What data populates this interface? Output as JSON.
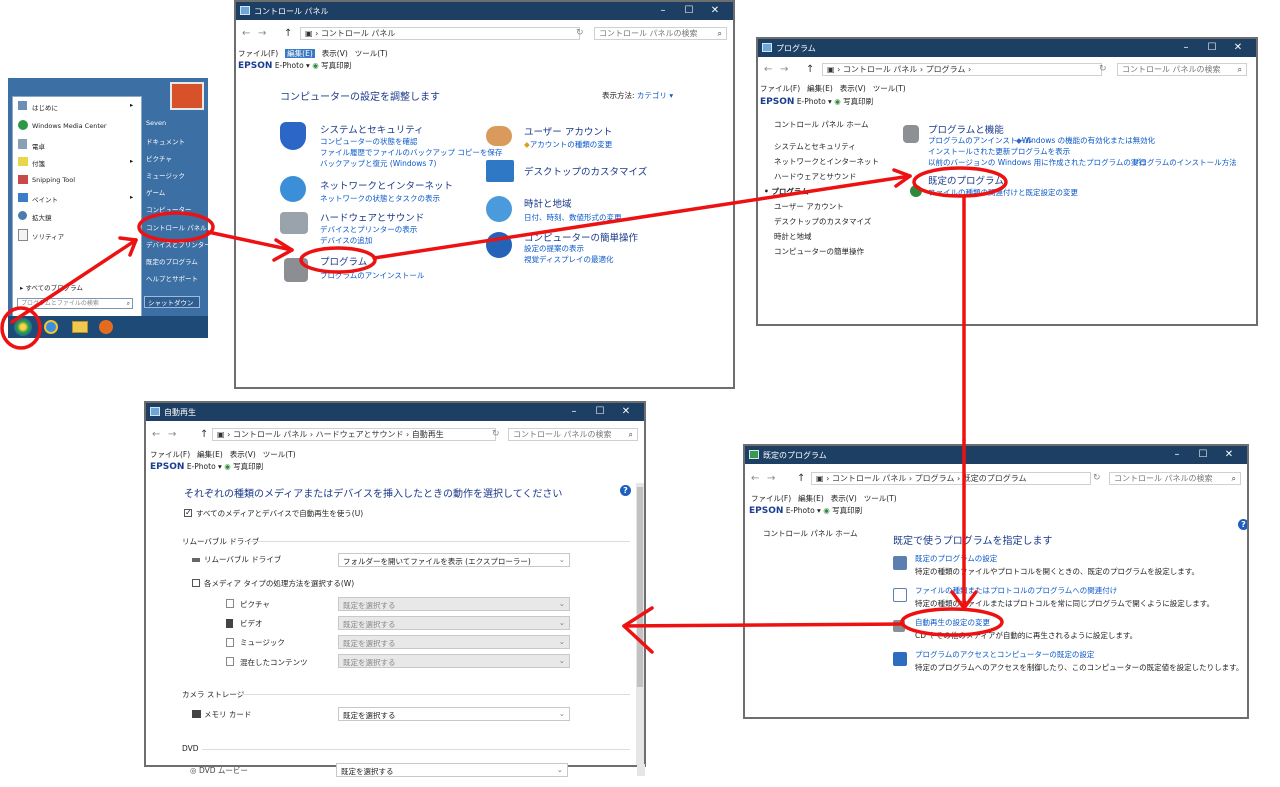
{
  "start_menu": {
    "left_items": [
      "はじめに",
      "Windows Media Center",
      "電卓",
      "付箋",
      "Snipping Tool",
      "ペイント",
      "拡大鏡",
      "ソリティア"
    ],
    "all_programs": "すべてのプログラム",
    "search_placeholder": "プログラムとファイルの検索",
    "right_items": [
      "Seven",
      "ドキュメント",
      "ピクチャ",
      "ミュージック",
      "ゲーム",
      "コンピューター",
      "コントロール パネル",
      "デバイスとプリンター",
      "既定のプログラム",
      "ヘルプとサポート"
    ],
    "shutdown": "シャットダウン"
  },
  "common": {
    "menu": [
      "ファイル(F)",
      "編集(E)",
      "表示(V)",
      "ツール(T)"
    ],
    "epson": "EPSON",
    "ephoto": "E-Photo",
    "print": "写真印刷",
    "search_placeholder": "コントロール パネルの検索"
  },
  "cp": {
    "title": "コントロール パネル",
    "path": "コントロール パネル",
    "heading": "コンピューターの設定を調整します",
    "view_label": "表示方法:",
    "view_value": "カテゴリ",
    "cats": [
      {
        "title": "システムとセキュリティ",
        "links": [
          "コンピューターの状態を確認",
          "ファイル履歴でファイルのバックアップ コピーを保存",
          "バックアップと復元 (Windows 7)"
        ]
      },
      {
        "title": "ネットワークとインターネット",
        "links": [
          "ネットワークの状態とタスクの表示"
        ]
      },
      {
        "title": "ハードウェアとサウンド",
        "links": [
          "デバイスとプリンターの表示",
          "デバイスの追加"
        ]
      },
      {
        "title": "プログラム",
        "links": [
          "プログラムのアンインストール"
        ]
      },
      {
        "title": "ユーザー アカウント",
        "links": [
          "アカウントの種類の変更"
        ]
      },
      {
        "title": "デスクトップのカスタマイズ",
        "links": []
      },
      {
        "title": "時計と地域",
        "links": [
          "日付、時刻、数値形式の変更"
        ]
      },
      {
        "title": "コンピューターの簡単操作",
        "links": [
          "設定の提案の表示",
          "視覚ディスプレイの最適化"
        ]
      }
    ]
  },
  "prog": {
    "title": "プログラム",
    "path": "コントロール パネル › プログラム ›",
    "sidebar": [
      "コントロール パネル ホーム",
      "システムとセキュリティ",
      "ネットワークとインターネット",
      "ハードウェアとサウンド",
      "プログラム",
      "ユーザー アカウント",
      "デスクトップのカスタマイズ",
      "時計と地域",
      "コンピューターの簡単操作"
    ],
    "sec1_title": "プログラムと機能",
    "sec1_links": [
      "プログラムのアンインストール",
      "Windows の機能の有効化または無効化",
      "インストールされた更新プログラムを表示",
      "以前のバージョンの Windows 用に作成されたプログラムの実行",
      "プログラムのインストール方法"
    ],
    "sec2_title": "既定のプログラム",
    "sec2_links": [
      "ファイルの種類の関連付けと既定設定の変更"
    ]
  },
  "autoplay": {
    "title": "自動再生",
    "path": "コントロール パネル › ハードウェアとサウンド › 自動再生",
    "heading": "それぞれの種類のメディアまたはデバイスを挿入したときの動作を選択してください",
    "use_all": "すべてのメディアとデバイスで自動再生を使う(U)",
    "removable_header": "リムーバブル ドライブ",
    "removable_label": "リムーバブル ドライブ",
    "removable_value": "フォルダーを開いてファイルを表示 (エクスプローラー)",
    "per_type": "各メディア タイプの処理方法を選択する(W)",
    "types": [
      "ピクチャ",
      "ビデオ",
      "ミュージック",
      "混在したコンテンツ"
    ],
    "choose": "既定を選択する",
    "camera_header": "カメラ ストレージ",
    "memory_card": "メモリ カード",
    "dvd_header": "DVD",
    "dvd_movie": "DVD ムービー"
  },
  "defaults": {
    "title": "既定のプログラム",
    "path": "コントロール パネル › プログラム › 既定のプログラム",
    "sidebar_home": "コントロール パネル ホーム",
    "heading": "既定で使うプログラムを指定します",
    "items": [
      {
        "link": "既定のプログラムの設定",
        "desc": "特定の種類のファイルやプロトコルを開くときの、既定のプログラムを設定します。"
      },
      {
        "link": "ファイルの種類またはプロトコルのプログラムへの関連付け",
        "desc": "特定の種類のファイルまたはプロトコルを常に同じプログラムで開くように設定します。"
      },
      {
        "link": "自動再生の設定の変更",
        "desc": "CD やその他のメディアが自動的に再生されるように設定します。"
      },
      {
        "link": "プログラムのアクセスとコンピューターの既定の設定",
        "desc": "特定のプログラムへのアクセスを制御したり、このコンピューターの既定値を設定したりします。"
      }
    ]
  },
  "colors": {
    "annotation": "#ee1111",
    "titlebar": "#1d3f63",
    "link": "#0a58c9"
  }
}
